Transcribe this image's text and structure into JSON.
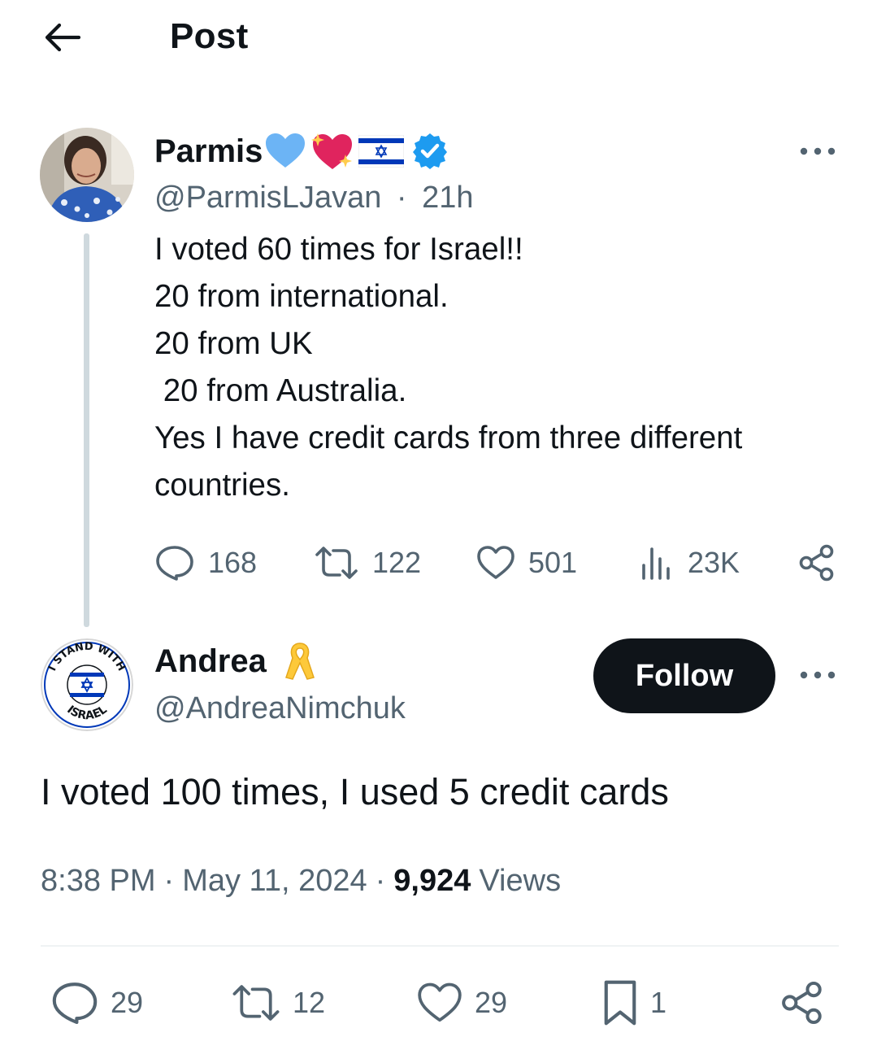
{
  "header": {
    "title": "Post",
    "back_icon": "arrow-left-icon"
  },
  "parent_post": {
    "author": {
      "display_name": "Parmis",
      "name_emojis": [
        "blue-heart",
        "sparkling-heart",
        "israel-flag"
      ],
      "verified": true,
      "handle": "@ParmisLJavan",
      "separator": "·",
      "time_ago": "21h"
    },
    "text": "I voted 60 times for Israel!!\n20 from international.\n20 from UK\n 20 from Australia.\nYes I have credit cards from three different\ncountries.",
    "actions": {
      "replies": "168",
      "reposts": "122",
      "likes": "501",
      "views": "23K"
    }
  },
  "main_post": {
    "author": {
      "display_name": "Andrea",
      "name_emoji": "yellow-ribbon",
      "handle": "@AndreaNimchuk",
      "avatar_text_top": "I STAND WITH",
      "avatar_text_bottom": "ISRAEL"
    },
    "follow_label": "Follow",
    "text": "I voted 100 times, I used 5 credit cards",
    "time": "8:38 PM",
    "date": "May 11, 2024",
    "separator": "·",
    "views_count": "9,924",
    "views_label": "Views",
    "actions": {
      "replies": "29",
      "reposts": "12",
      "likes": "29",
      "bookmarks": "1"
    }
  },
  "colors": {
    "text_primary": "#0f1419",
    "text_secondary": "#536471",
    "verified_blue": "#1d9bf0",
    "thread_line": "#cfd9de",
    "follow_bg": "#0f1419",
    "israel_blue": "#0038b8"
  }
}
